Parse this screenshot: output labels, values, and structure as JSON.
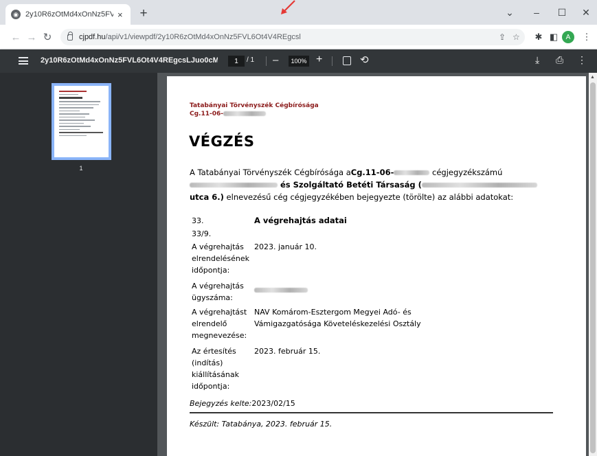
{
  "browser": {
    "tab_title": "2y10R6zOtMd4xOnNz5FVL6Ot4V",
    "tab_close": "×",
    "new_tab": "+",
    "window_controls": [
      "⌄",
      "–",
      "☐",
      "✕"
    ],
    "url_host": "cjpdf.hu",
    "url_path": "/api/v1/viewpdf/2y10R6zOtMd4xOnNz5FVL6Ot4V4REgcsl",
    "profile_initial": "A",
    "icons": [
      "back-icon",
      "forward-icon",
      "reload-icon",
      "lock-icon",
      "share-icon",
      "star-icon",
      "extensions-icon",
      "sidepanel-icon",
      "menu-icon"
    ],
    "annotation_color": "#e53935"
  },
  "pdf_toolbar": {
    "title": "2y10R6zOtMd4xOnNz5FVL6Ot4V4REgcsLJuo0cMEVY...",
    "page_current": "1",
    "page_total": "/ 1",
    "zoom_minus": "–",
    "zoom_value": "100%",
    "zoom_plus": "+",
    "download_icon": "⤓",
    "print_icon": "⎙",
    "more_icon": "⋮"
  },
  "sidebar": {
    "thumbnail_label": "1"
  },
  "document": {
    "court_name": "Tatabányai Törvényszék Cégbírósága",
    "case_prefix": "Cg.11-06-",
    "heading": "VÉGZÉS",
    "intro_part1": "A Tatabányai Törvényszék Cégbírósága a",
    "intro_case_prefix": "Cg.11-06-",
    "intro_part2": " cégjegyzékszámú",
    "intro_company_suffix": " és Szolgáltató Betéti Társaság (",
    "intro_address_end": "utca 6.)",
    "intro_part3": " elnevezésű cég cégjegyzékében bejegyezte (törölte) az alábbi adatokat:",
    "section_number": "33.",
    "section_title": "A végrehajtás adatai",
    "subsection": "33/9.",
    "rows": [
      {
        "label": "A végrehajtás elrendelésének időpontja:",
        "value": "2023. január 10."
      },
      {
        "label": "A végrehajtás ügyszáma:",
        "value": ""
      },
      {
        "label": "A végrehajtást elrendelő megnevezése:",
        "value": "NAV Komárom-Esztergom Megyei Adó- és Vámigazgatósága Követeléskezelési Osztály"
      },
      {
        "label": "Az értesítés (indítás) kiállításának időpontja:",
        "value": "2023. február 15."
      }
    ],
    "entry_date_label": "Bejegyzés kelte:",
    "entry_date_value": "2023/02/15",
    "made_at": "Készült: Tatabánya, 2023. február 15."
  }
}
